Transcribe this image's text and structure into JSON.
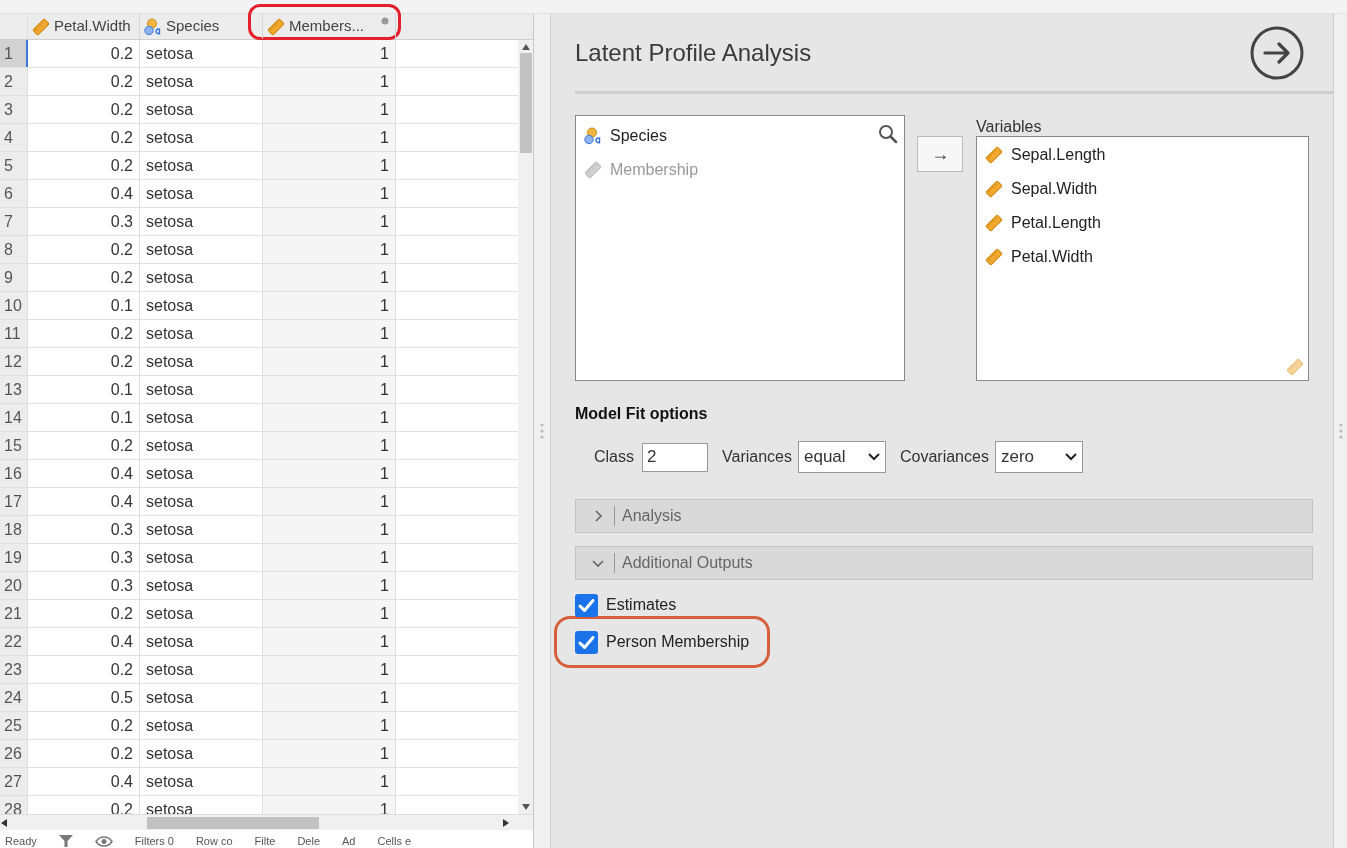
{
  "data_grid": {
    "columns": [
      {
        "name": "Petal.Width",
        "kind": "continuous",
        "highlighted": false
      },
      {
        "name": "Species",
        "kind": "nominal",
        "highlighted": false
      },
      {
        "name": "Members...",
        "kind": "computed",
        "highlighted": true
      }
    ],
    "rows": [
      {
        "index": "1",
        "cells": [
          "0.2",
          "setosa",
          "1"
        ],
        "selected": true
      },
      {
        "index": "2",
        "cells": [
          "0.2",
          "setosa",
          "1"
        ],
        "selected": false
      },
      {
        "index": "3",
        "cells": [
          "0.2",
          "setosa",
          "1"
        ],
        "selected": false
      },
      {
        "index": "4",
        "cells": [
          "0.2",
          "setosa",
          "1"
        ],
        "selected": false
      },
      {
        "index": "5",
        "cells": [
          "0.2",
          "setosa",
          "1"
        ],
        "selected": false
      },
      {
        "index": "6",
        "cells": [
          "0.4",
          "setosa",
          "1"
        ],
        "selected": false
      },
      {
        "index": "7",
        "cells": [
          "0.3",
          "setosa",
          "1"
        ],
        "selected": false
      },
      {
        "index": "8",
        "cells": [
          "0.2",
          "setosa",
          "1"
        ],
        "selected": false
      },
      {
        "index": "9",
        "cells": [
          "0.2",
          "setosa",
          "1"
        ],
        "selected": false
      },
      {
        "index": "10",
        "cells": [
          "0.1",
          "setosa",
          "1"
        ],
        "selected": false
      },
      {
        "index": "11",
        "cells": [
          "0.2",
          "setosa",
          "1"
        ],
        "selected": false
      },
      {
        "index": "12",
        "cells": [
          "0.2",
          "setosa",
          "1"
        ],
        "selected": false
      },
      {
        "index": "13",
        "cells": [
          "0.1",
          "setosa",
          "1"
        ],
        "selected": false
      },
      {
        "index": "14",
        "cells": [
          "0.1",
          "setosa",
          "1"
        ],
        "selected": false
      },
      {
        "index": "15",
        "cells": [
          "0.2",
          "setosa",
          "1"
        ],
        "selected": false
      },
      {
        "index": "16",
        "cells": [
          "0.4",
          "setosa",
          "1"
        ],
        "selected": false
      },
      {
        "index": "17",
        "cells": [
          "0.4",
          "setosa",
          "1"
        ],
        "selected": false
      },
      {
        "index": "18",
        "cells": [
          "0.3",
          "setosa",
          "1"
        ],
        "selected": false
      },
      {
        "index": "19",
        "cells": [
          "0.3",
          "setosa",
          "1"
        ],
        "selected": false
      },
      {
        "index": "20",
        "cells": [
          "0.3",
          "setosa",
          "1"
        ],
        "selected": false
      },
      {
        "index": "21",
        "cells": [
          "0.2",
          "setosa",
          "1"
        ],
        "selected": false
      },
      {
        "index": "22",
        "cells": [
          "0.4",
          "setosa",
          "1"
        ],
        "selected": false
      },
      {
        "index": "23",
        "cells": [
          "0.2",
          "setosa",
          "1"
        ],
        "selected": false
      },
      {
        "index": "24",
        "cells": [
          "0.5",
          "setosa",
          "1"
        ],
        "selected": false
      },
      {
        "index": "25",
        "cells": [
          "0.2",
          "setosa",
          "1"
        ],
        "selected": false
      },
      {
        "index": "26",
        "cells": [
          "0.2",
          "setosa",
          "1"
        ],
        "selected": false
      },
      {
        "index": "27",
        "cells": [
          "0.4",
          "setosa",
          "1"
        ],
        "selected": false
      },
      {
        "index": "28",
        "cells": [
          "0.2",
          "setosa",
          "1"
        ],
        "selected": false
      }
    ]
  },
  "status_bar": [
    {
      "kind": "text",
      "label": "Ready"
    },
    {
      "kind": "filter-icon"
    },
    {
      "kind": "eye-icon"
    },
    {
      "kind": "text",
      "label": "Filters 0"
    },
    {
      "kind": "text",
      "label": "Row co"
    },
    {
      "kind": "text",
      "label": "Filte"
    },
    {
      "kind": "text",
      "label": "Dele"
    },
    {
      "kind": "text",
      "label": "Ad"
    },
    {
      "kind": "text",
      "label": "Cells e"
    }
  ],
  "analysis": {
    "title": "Latent Profile Analysis",
    "source_list": [
      {
        "label": "Species",
        "kind": "nominal",
        "disabled": false
      },
      {
        "label": "Membership",
        "kind": "continuous",
        "disabled": true
      }
    ],
    "move_button": "→",
    "target_label": "Variables",
    "target_list": [
      {
        "label": "Sepal.Length",
        "kind": "continuous"
      },
      {
        "label": "Sepal.Width",
        "kind": "continuous"
      },
      {
        "label": "Petal.Length",
        "kind": "continuous"
      },
      {
        "label": "Petal.Width",
        "kind": "continuous"
      }
    ],
    "model_fit": {
      "heading": "Model Fit options",
      "class_label": "Class",
      "class_value": "2",
      "variances_label": "Variances",
      "variances_value": "equal",
      "covariances_label": "Covariances",
      "covariances_value": "zero"
    },
    "sections": [
      {
        "label": "Analysis",
        "expanded": false
      },
      {
        "label": "Additional Outputs",
        "expanded": true
      }
    ],
    "options": [
      {
        "label": "Estimates",
        "checked": true,
        "highlighted": false
      },
      {
        "label": "Person Membership",
        "checked": true,
        "highlighted": true
      }
    ]
  }
}
